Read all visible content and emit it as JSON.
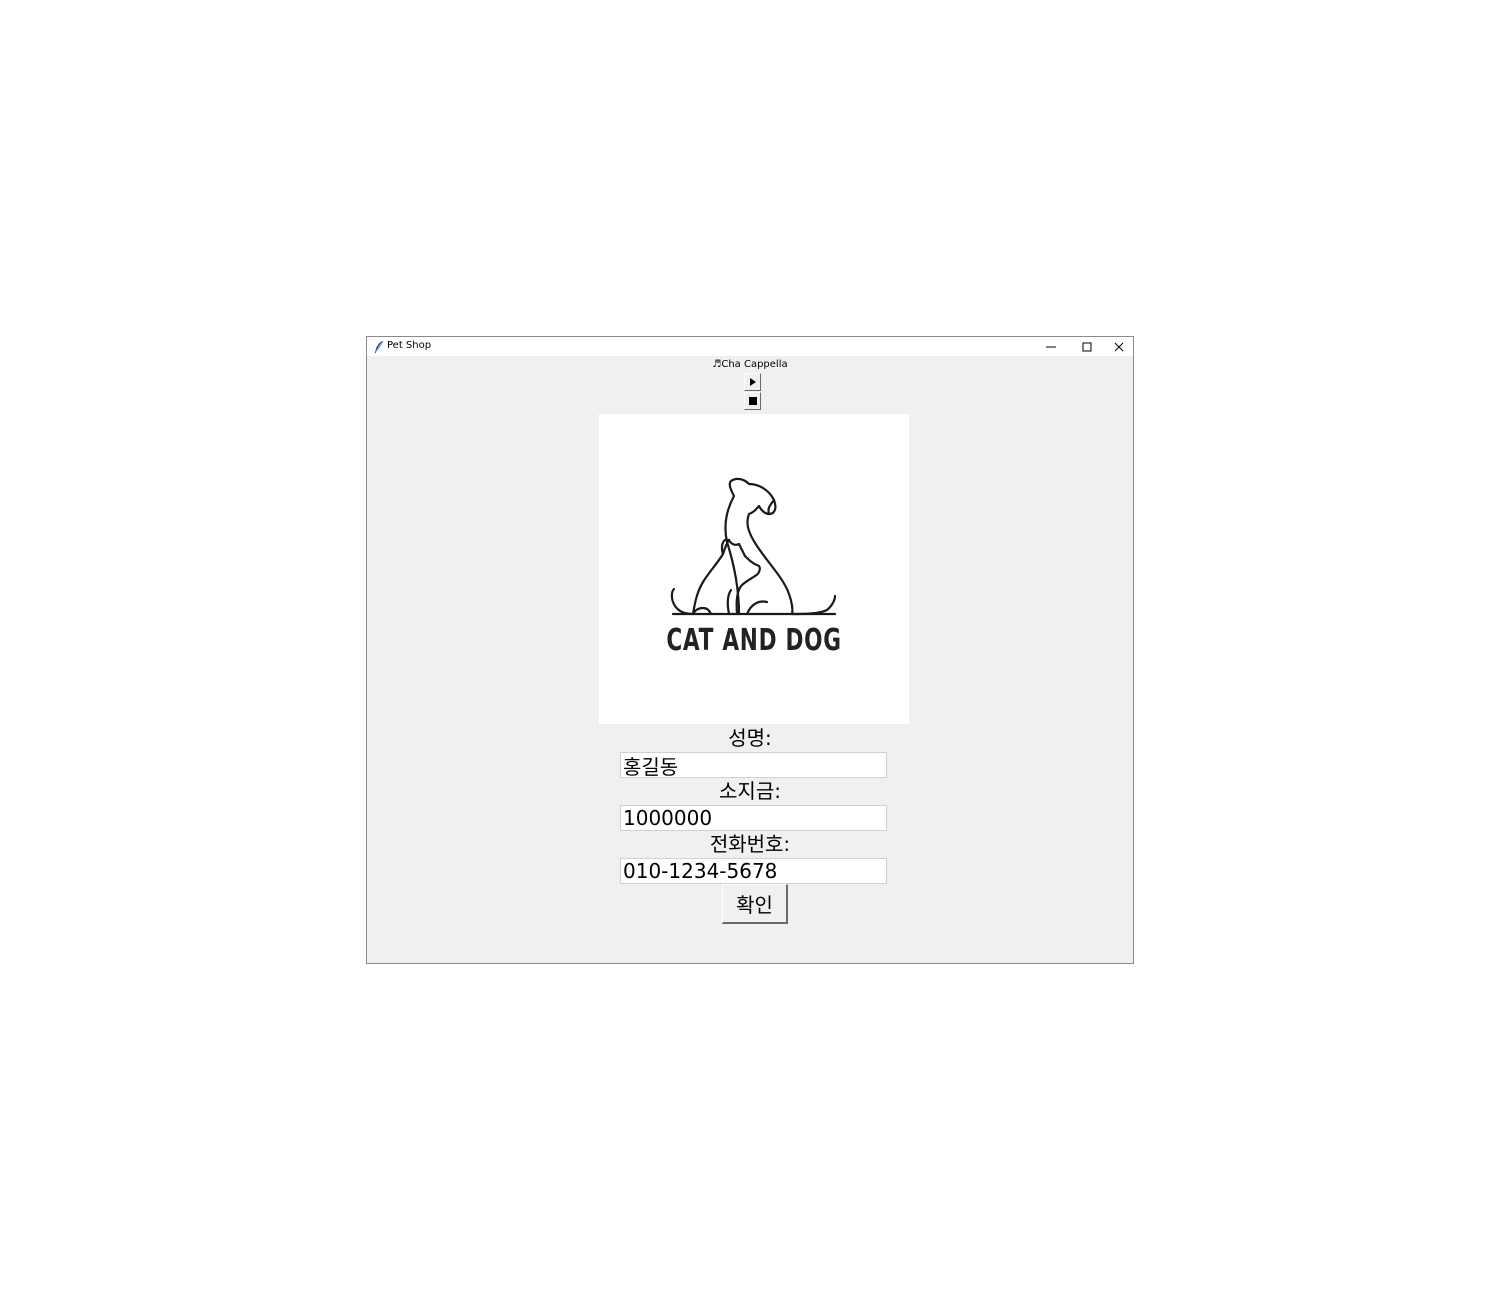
{
  "window": {
    "title": "Pet Shop",
    "minimize_icon": "minimize-icon",
    "maximize_icon": "maximize-icon",
    "close_icon": "close-icon"
  },
  "music": {
    "now_playing": "♬Cha Cappella",
    "play_icon": "play-icon",
    "stop_icon": "stop-icon"
  },
  "logo": {
    "text": "CAT AND DOG",
    "icon": "cat-and-dog-logo"
  },
  "form": {
    "name_label": "성명:",
    "name_value": "홍길동",
    "money_label": "소지금:",
    "money_value": "1000000",
    "phone_label": "전화번호:",
    "phone_value": "010-1234-5678",
    "confirm_label": "확인"
  }
}
